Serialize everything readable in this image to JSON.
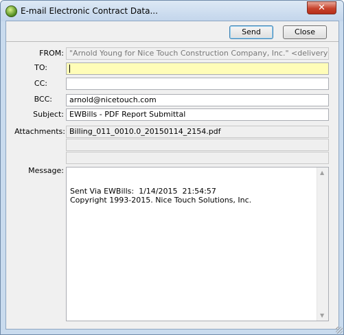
{
  "window": {
    "title": "E-mail Electronic Contract Data...",
    "close_glyph": "✕"
  },
  "toolbar": {
    "send_label": "Send",
    "close_label": "Close"
  },
  "form": {
    "from_label": "FROM:",
    "from_value": "\"Arnold Young for Nice Touch Construction Company, Inc.\" <delivery@ew",
    "to_label": "TO:",
    "to_value": "",
    "cc_label": "CC:",
    "cc_value": "",
    "bcc_label": "BCC:",
    "bcc_value": "arnold@nicetouch.com",
    "subject_label": "Subject:",
    "subject_value": "EWBills - PDF Report Submittal",
    "attachments_label": "Attachments:",
    "attachments": [
      "Billing_011_0010.0_20150114_2154.pdf",
      "",
      ""
    ],
    "message_label": "Message:",
    "message_value": "Sent Via EWBills:  1/14/2015  21:54:57\nCopyright 1993-2015. Nice Touch Solutions, Inc."
  },
  "icons": {
    "scroll_up": "▲",
    "scroll_down": "▼"
  }
}
